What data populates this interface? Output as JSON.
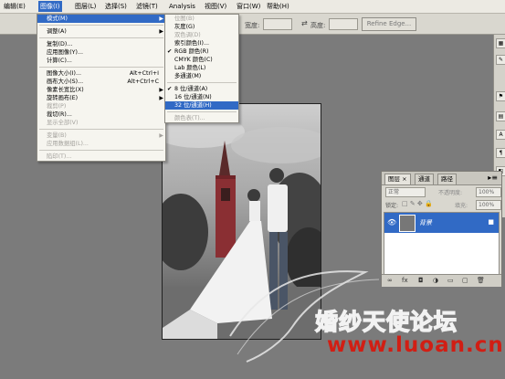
{
  "menubar": {
    "items": [
      "编辑(E)",
      "图像(I)",
      "图层(L)",
      "选择(S)",
      "滤镜(T)",
      "Analysis",
      "视图(V)",
      "窗口(W)",
      "帮助(H)"
    ]
  },
  "options": {
    "width_label": "宽度:",
    "height_label": "高度:",
    "refine_edge": "Refine Edge..."
  },
  "image_menu": {
    "items": [
      {
        "label": "模式(M)",
        "shortcut": "",
        "arrow": true,
        "disabled": false,
        "highlight": true
      },
      {
        "sep": true
      },
      {
        "label": "调整(A)",
        "shortcut": "",
        "arrow": true,
        "disabled": false
      },
      {
        "sep": true
      },
      {
        "label": "复制(D)...",
        "shortcut": "",
        "disabled": false
      },
      {
        "label": "应用图像(Y)...",
        "shortcut": "",
        "disabled": false
      },
      {
        "label": "计算(C)...",
        "shortcut": "",
        "disabled": false
      },
      {
        "sep": true
      },
      {
        "label": "图像大小(I)...",
        "shortcut": "Alt+Ctrl+I",
        "disabled": false
      },
      {
        "label": "画布大小(S)...",
        "shortcut": "Alt+Ctrl+C",
        "disabled": false
      },
      {
        "label": "像素长宽比(X)",
        "shortcut": "",
        "arrow": true,
        "disabled": false
      },
      {
        "label": "旋转画布(E)",
        "shortcut": "",
        "arrow": true,
        "disabled": false
      },
      {
        "label": "裁剪(P)",
        "shortcut": "",
        "disabled": true
      },
      {
        "label": "裁切(R)...",
        "shortcut": "",
        "disabled": false
      },
      {
        "label": "显示全部(V)",
        "shortcut": "",
        "disabled": true
      },
      {
        "sep": true
      },
      {
        "label": "变量(B)",
        "shortcut": "",
        "arrow": true,
        "disabled": true
      },
      {
        "label": "应用数据组(L)...",
        "shortcut": "",
        "disabled": true
      },
      {
        "sep": true
      },
      {
        "label": "陷印(T)...",
        "shortcut": "",
        "disabled": true
      }
    ]
  },
  "mode_menu": {
    "items": [
      {
        "label": "位图(B)",
        "disabled": true
      },
      {
        "label": "灰度(G)",
        "disabled": false
      },
      {
        "label": "双色调(D)",
        "disabled": true
      },
      {
        "label": "索引颜色(I)...",
        "disabled": false
      },
      {
        "label": "RGB 颜色(R)",
        "disabled": false,
        "checked": true
      },
      {
        "label": "CMYK 颜色(C)",
        "disabled": false
      },
      {
        "label": "Lab 颜色(L)",
        "disabled": false
      },
      {
        "label": "多通道(M)",
        "disabled": false
      },
      {
        "sep": true
      },
      {
        "label": "8 位/通道(A)",
        "disabled": false,
        "checked": true
      },
      {
        "label": "16 位/通道(N)",
        "disabled": false
      },
      {
        "label": "32 位/通道(H)",
        "disabled": false,
        "highlight": true
      },
      {
        "sep": true
      },
      {
        "label": "颜色表(T)...",
        "disabled": true
      }
    ]
  },
  "layers_panel": {
    "tabs": [
      "图层",
      "通道",
      "路径"
    ],
    "blend_mode": "正常",
    "opacity_label": "不透明度:",
    "opacity_value": "100%",
    "lock_label": "锁定:",
    "fill_label": "填充:",
    "fill_value": "100%",
    "layer_name": "背景"
  },
  "watermark": {
    "forum": "婚纱天使论坛",
    "url": "www.luoan.cn"
  },
  "colors": {
    "highlight": "#316ac5",
    "watermark_url": "#d11e14"
  }
}
